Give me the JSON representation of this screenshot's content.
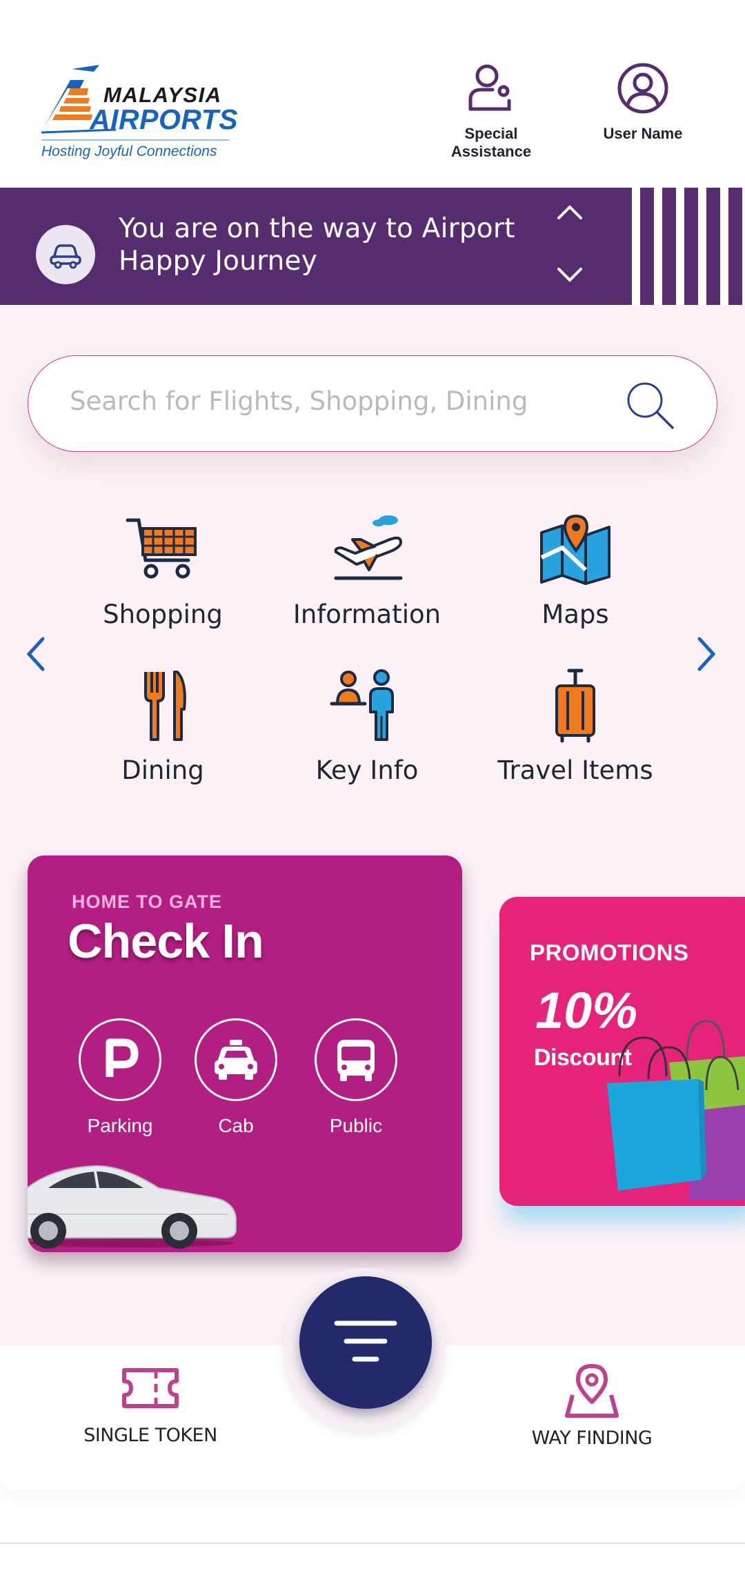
{
  "header": {
    "logo": {
      "name_line1": "MALAYSIA",
      "name_line2": "AIRPORTS",
      "tagline": "Hosting Joyful Connections",
      "colors": {
        "blue": "#1565c0",
        "orange": "#f07b1e"
      }
    },
    "special_assistance": {
      "label": "Special Assistance",
      "icon": "assistance-icon"
    },
    "user": {
      "label": "User Name",
      "icon": "user-icon"
    }
  },
  "journey": {
    "line1": "You are on the way to Airport",
    "line2": "Happy Journey",
    "icon": "car-icon",
    "background": "#552d6e"
  },
  "search": {
    "placeholder": "Search for Flights, Shopping, Dining",
    "icon": "search-icon"
  },
  "categories": [
    {
      "label": "Shopping",
      "icon": "shopping-cart-icon"
    },
    {
      "label": "Information",
      "icon": "plane-icon"
    },
    {
      "label": "Maps",
      "icon": "map-icon"
    },
    {
      "label": "Dining",
      "icon": "fork-knife-icon"
    },
    {
      "label": "Key Info",
      "icon": "info-desk-icon"
    },
    {
      "label": "Travel Items",
      "icon": "luggage-icon"
    }
  ],
  "checkin": {
    "subtitle": "HOME TO GATE",
    "title": "Check In",
    "options": [
      {
        "label": "Parking",
        "icon": "parking-icon"
      },
      {
        "label": "Cab",
        "icon": "taxi-icon"
      },
      {
        "label": "Public",
        "icon": "bus-icon"
      }
    ],
    "background": "#b31e82"
  },
  "promotions": {
    "title": "PROMOTIONS",
    "value": "10%",
    "label": "Discount",
    "background": "#e6237a"
  },
  "bottom_nav": {
    "token": {
      "label": "SINGLE TOKEN",
      "icon": "ticket-icon"
    },
    "menu": {
      "icon": "menu-filter-icon"
    },
    "wayfinding": {
      "label": "WAY FINDING",
      "icon": "location-pin-icon"
    }
  },
  "colors": {
    "accent_magenta": "#c2408b",
    "navy": "#23296a",
    "orange": "#f07b1e",
    "sky": "#29a3dd"
  }
}
